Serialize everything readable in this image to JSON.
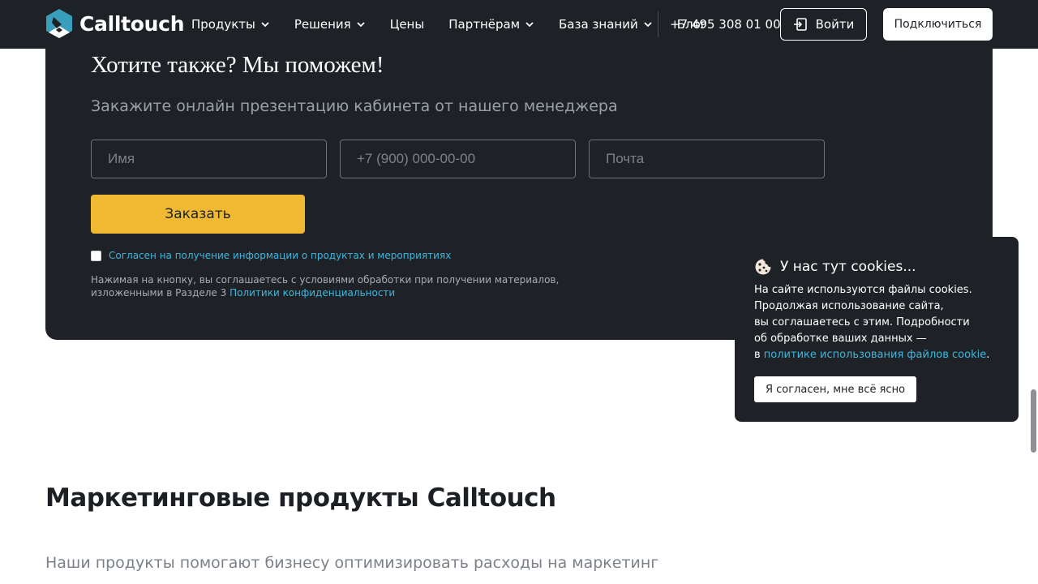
{
  "header": {
    "logo_text": "Calltouch",
    "nav": [
      {
        "label": "Продукты",
        "dropdown": true
      },
      {
        "label": "Решения",
        "dropdown": true
      },
      {
        "label": "Цены",
        "dropdown": false
      },
      {
        "label": "Партнёрам",
        "dropdown": true
      },
      {
        "label": "База знаний",
        "dropdown": true
      },
      {
        "label": "Блог",
        "dropdown": false
      }
    ],
    "phone": "+7 495 308 01 00",
    "login_label": "Войти",
    "connect_label": "Подключиться"
  },
  "form": {
    "title": "Хотите также? Мы поможем!",
    "subtitle": "Закажите онлайн презентацию кабинета от нашего менеджера",
    "name_placeholder": "Имя",
    "phone_placeholder": "+7 (900) 000-00-00",
    "email_placeholder": "Почта",
    "submit_label": "Заказать",
    "consent_label": "Согласен на получение информации о продуктах и мероприятиях",
    "consent_checked": false,
    "legal_text": "Нажимая на кнопку, вы соглашаетесь с условиями обработки при получении материалов, изложенными в Разделе 3 ",
    "legal_link": "Политики конфиденциальности"
  },
  "cookie": {
    "title": "У нас тут cookies...",
    "lines": [
      "На сайте используются файлы cookies.",
      "Продолжая использование сайта,",
      "вы соглашаетесь с этим. Подробности",
      "об обработке ваших данных —"
    ],
    "link_prefix": "в ",
    "link_text": "политике использования файлов cookie",
    "link_suffix": ".",
    "accept_label": "Я согласен, мне всё ясно"
  },
  "section": {
    "title": "Маркетинговые продукты Calltouch",
    "subtitle": "Наши продукты помогают бизнесу оптимизировать расходы на маркетинг"
  },
  "colors": {
    "dark": "#1e2227",
    "accent_yellow": "#f0b932",
    "link_blue": "#3fb7dd",
    "logo_teal": "#3a9fbd"
  }
}
